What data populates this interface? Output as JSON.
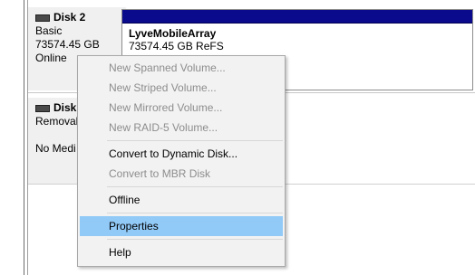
{
  "disk2": {
    "name": "Disk 2",
    "type": "Basic",
    "size": "73574.45 GB",
    "status": "Online"
  },
  "disk3": {
    "name": "Disk",
    "type": "Removal",
    "status": "No Medi"
  },
  "partition": {
    "name": "LyveMobileArray",
    "info": "73574.45 GB ReFS"
  },
  "menu": {
    "items": [
      {
        "label": "New Spanned Volume...",
        "enabled": false
      },
      {
        "label": "New Striped Volume...",
        "enabled": false
      },
      {
        "label": "New Mirrored Volume...",
        "enabled": false
      },
      {
        "label": "New RAID-5 Volume...",
        "enabled": false
      },
      {
        "label": "Convert to Dynamic Disk...",
        "enabled": true
      },
      {
        "label": "Convert to MBR Disk",
        "enabled": false
      },
      {
        "label": "Offline",
        "enabled": true
      },
      {
        "label": "Properties",
        "enabled": true,
        "highlighted": true
      },
      {
        "label": "Help",
        "enabled": true
      }
    ]
  },
  "colors": {
    "partition_bar": "#0a0a8c",
    "menu_highlight": "#91c9f7",
    "disabled_text": "#8d8d8d"
  }
}
